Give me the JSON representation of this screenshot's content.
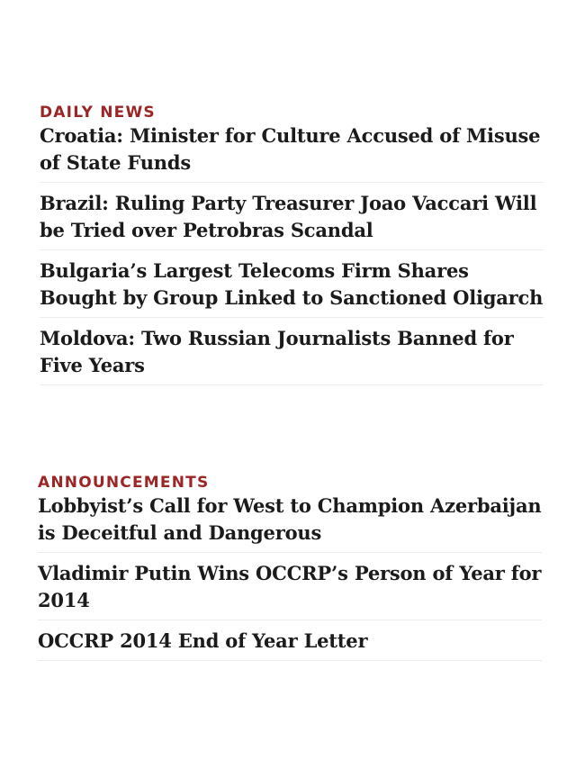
{
  "daily_news": {
    "label": "DAILY NEWS",
    "items": [
      "Croatia: Minister for Culture Accused of Misuse of State Funds",
      "Brazil: Ruling Party Treasurer Joao Vaccari Will be Tried over Petrobras Scandal",
      "Bulgaria’s Largest Telecoms Firm Shares Bought by Group Linked to Sanctioned Oligarch",
      "Moldova: Two Russian Journalists Banned for Five Years"
    ]
  },
  "announcements": {
    "label": "ANNOUNCEMENTS",
    "items": [
      "Lobbyist’s Call for West to Champion Azerbaijan is Deceitful and Dangerous",
      "Vladimir Putin Wins OCCRP’s Person of Year for 2014",
      "OCCRP 2014 End of Year Letter"
    ]
  },
  "colors": {
    "label": "#9b2626",
    "headline": "#1b1b1b",
    "divider": "#ececec"
  }
}
